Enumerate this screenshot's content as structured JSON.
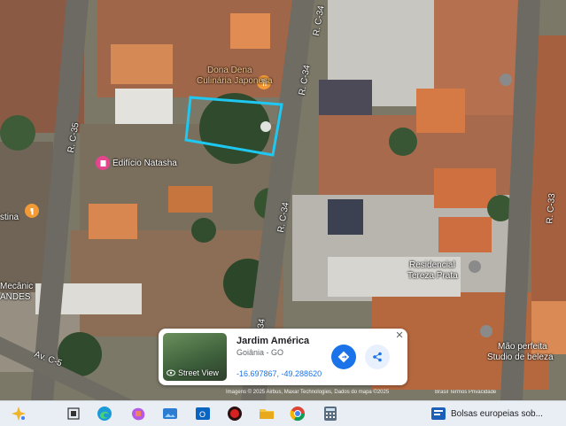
{
  "map": {
    "places": {
      "restaurant_line1": "Dona Dena",
      "restaurant_line2": "Culinária Japonesa",
      "building_center": "Edifício Natasha",
      "left_place": "stina",
      "left_mechanic_1": "Mecânic",
      "left_mechanic_2": "ANDES",
      "residencial_1": "Residencial",
      "residencial_2": "Tereza Prata",
      "right_place_1": "Mão perfeita",
      "right_place_2": "Studio de beleza"
    },
    "roads": {
      "c34_top": "R. C-34",
      "c34_mid": "R. C-34",
      "c34_bottom": "34",
      "c35": "R. C-35",
      "c33": "R. C-33",
      "c5": "Av. C-5"
    },
    "highlight_color": "#1ec8f0"
  },
  "place_card": {
    "title": "Jardim América",
    "subtitle": "Goiânia - GO",
    "coordinates": "-16.697867, -49.288620",
    "street_view_label": "Street View",
    "close_label": "✕",
    "directions_icon": "directions-icon",
    "share_icon": "share-icon"
  },
  "attribution": {
    "imagery": "Imagens © 2025 Airbus, Maxar Technologies, Dados do mapa ©2025",
    "links": "Brasil   Termos   Privacidade"
  },
  "taskbar": {
    "icons": [
      "copilot-icon",
      "task-view-icon",
      "edge-icon",
      "copilot-app-icon",
      "photos-icon",
      "outlook-icon",
      "app-red-icon",
      "file-explorer-icon",
      "chrome-icon",
      "calculator-icon"
    ],
    "news_text": "Bolsas europeias sob..."
  }
}
